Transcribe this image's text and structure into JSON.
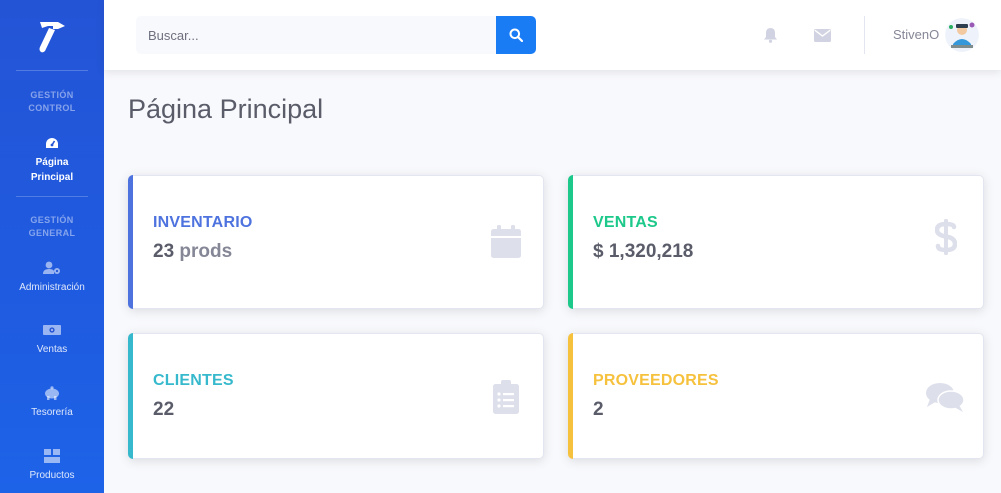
{
  "sidebar": {
    "brand_icon": "hammer-icon",
    "sections": [
      {
        "heading": "GESTIÓN\nCONTROL"
      },
      {
        "heading": "GESTIÓN\nGENERAL"
      }
    ],
    "items": [
      {
        "label": "Página\nPrincipal",
        "icon": "tachometer-icon",
        "active": true
      },
      {
        "label": "Administración",
        "icon": "user-cog-icon"
      },
      {
        "label": "Ventas",
        "icon": "money-bill-icon"
      },
      {
        "label": "Tesorería",
        "icon": "piggy-bank-icon"
      },
      {
        "label": "Productos",
        "icon": "boxes-icon"
      }
    ]
  },
  "topbar": {
    "search_placeholder": "Buscar...",
    "user_name": "StivenO"
  },
  "main": {
    "page_title": "Página Principal",
    "cards": [
      {
        "title": "INVENTARIO",
        "value": "23",
        "unit": "prods",
        "color": "#4e73df",
        "icon": "calendar-icon"
      },
      {
        "title": "VENTAS",
        "value": "$ 1,320,218",
        "unit": "",
        "color": "#1cc88a",
        "icon": "dollar-icon"
      },
      {
        "title": "CLIENTES",
        "value": "22",
        "unit": "",
        "color": "#36b9cc",
        "icon": "clipboard-list-icon"
      },
      {
        "title": "PROVEEDORES",
        "value": "2",
        "unit": "",
        "color": "#f6c23e",
        "icon": "comments-icon"
      }
    ]
  },
  "colors": {
    "sidebar": "#2454d6",
    "search_button": "#1a7cf5",
    "card_icon": "#dddfeb"
  }
}
